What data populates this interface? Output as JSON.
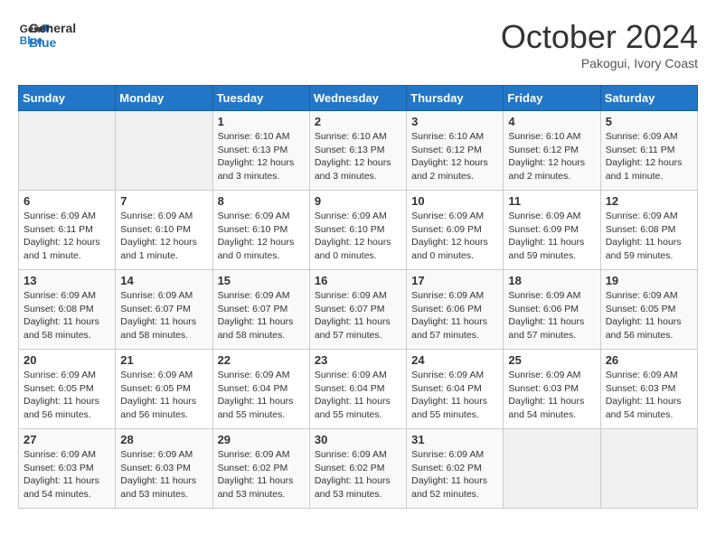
{
  "header": {
    "logo_line1": "General",
    "logo_line2": "Blue",
    "month": "October 2024",
    "location": "Pakogui, Ivory Coast"
  },
  "days_of_week": [
    "Sunday",
    "Monday",
    "Tuesday",
    "Wednesday",
    "Thursday",
    "Friday",
    "Saturday"
  ],
  "weeks": [
    [
      {
        "day": "",
        "info": ""
      },
      {
        "day": "",
        "info": ""
      },
      {
        "day": "1",
        "info": "Sunrise: 6:10 AM\nSunset: 6:13 PM\nDaylight: 12 hours and 3 minutes."
      },
      {
        "day": "2",
        "info": "Sunrise: 6:10 AM\nSunset: 6:13 PM\nDaylight: 12 hours and 3 minutes."
      },
      {
        "day": "3",
        "info": "Sunrise: 6:10 AM\nSunset: 6:12 PM\nDaylight: 12 hours and 2 minutes."
      },
      {
        "day": "4",
        "info": "Sunrise: 6:10 AM\nSunset: 6:12 PM\nDaylight: 12 hours and 2 minutes."
      },
      {
        "day": "5",
        "info": "Sunrise: 6:09 AM\nSunset: 6:11 PM\nDaylight: 12 hours and 1 minute."
      }
    ],
    [
      {
        "day": "6",
        "info": "Sunrise: 6:09 AM\nSunset: 6:11 PM\nDaylight: 12 hours and 1 minute."
      },
      {
        "day": "7",
        "info": "Sunrise: 6:09 AM\nSunset: 6:10 PM\nDaylight: 12 hours and 1 minute."
      },
      {
        "day": "8",
        "info": "Sunrise: 6:09 AM\nSunset: 6:10 PM\nDaylight: 12 hours and 0 minutes."
      },
      {
        "day": "9",
        "info": "Sunrise: 6:09 AM\nSunset: 6:10 PM\nDaylight: 12 hours and 0 minutes."
      },
      {
        "day": "10",
        "info": "Sunrise: 6:09 AM\nSunset: 6:09 PM\nDaylight: 12 hours and 0 minutes."
      },
      {
        "day": "11",
        "info": "Sunrise: 6:09 AM\nSunset: 6:09 PM\nDaylight: 11 hours and 59 minutes."
      },
      {
        "day": "12",
        "info": "Sunrise: 6:09 AM\nSunset: 6:08 PM\nDaylight: 11 hours and 59 minutes."
      }
    ],
    [
      {
        "day": "13",
        "info": "Sunrise: 6:09 AM\nSunset: 6:08 PM\nDaylight: 11 hours and 58 minutes."
      },
      {
        "day": "14",
        "info": "Sunrise: 6:09 AM\nSunset: 6:07 PM\nDaylight: 11 hours and 58 minutes."
      },
      {
        "day": "15",
        "info": "Sunrise: 6:09 AM\nSunset: 6:07 PM\nDaylight: 11 hours and 58 minutes."
      },
      {
        "day": "16",
        "info": "Sunrise: 6:09 AM\nSunset: 6:07 PM\nDaylight: 11 hours and 57 minutes."
      },
      {
        "day": "17",
        "info": "Sunrise: 6:09 AM\nSunset: 6:06 PM\nDaylight: 11 hours and 57 minutes."
      },
      {
        "day": "18",
        "info": "Sunrise: 6:09 AM\nSunset: 6:06 PM\nDaylight: 11 hours and 57 minutes."
      },
      {
        "day": "19",
        "info": "Sunrise: 6:09 AM\nSunset: 6:05 PM\nDaylight: 11 hours and 56 minutes."
      }
    ],
    [
      {
        "day": "20",
        "info": "Sunrise: 6:09 AM\nSunset: 6:05 PM\nDaylight: 11 hours and 56 minutes."
      },
      {
        "day": "21",
        "info": "Sunrise: 6:09 AM\nSunset: 6:05 PM\nDaylight: 11 hours and 56 minutes."
      },
      {
        "day": "22",
        "info": "Sunrise: 6:09 AM\nSunset: 6:04 PM\nDaylight: 11 hours and 55 minutes."
      },
      {
        "day": "23",
        "info": "Sunrise: 6:09 AM\nSunset: 6:04 PM\nDaylight: 11 hours and 55 minutes."
      },
      {
        "day": "24",
        "info": "Sunrise: 6:09 AM\nSunset: 6:04 PM\nDaylight: 11 hours and 55 minutes."
      },
      {
        "day": "25",
        "info": "Sunrise: 6:09 AM\nSunset: 6:03 PM\nDaylight: 11 hours and 54 minutes."
      },
      {
        "day": "26",
        "info": "Sunrise: 6:09 AM\nSunset: 6:03 PM\nDaylight: 11 hours and 54 minutes."
      }
    ],
    [
      {
        "day": "27",
        "info": "Sunrise: 6:09 AM\nSunset: 6:03 PM\nDaylight: 11 hours and 54 minutes."
      },
      {
        "day": "28",
        "info": "Sunrise: 6:09 AM\nSunset: 6:03 PM\nDaylight: 11 hours and 53 minutes."
      },
      {
        "day": "29",
        "info": "Sunrise: 6:09 AM\nSunset: 6:02 PM\nDaylight: 11 hours and 53 minutes."
      },
      {
        "day": "30",
        "info": "Sunrise: 6:09 AM\nSunset: 6:02 PM\nDaylight: 11 hours and 53 minutes."
      },
      {
        "day": "31",
        "info": "Sunrise: 6:09 AM\nSunset: 6:02 PM\nDaylight: 11 hours and 52 minutes."
      },
      {
        "day": "",
        "info": ""
      },
      {
        "day": "",
        "info": ""
      }
    ]
  ]
}
